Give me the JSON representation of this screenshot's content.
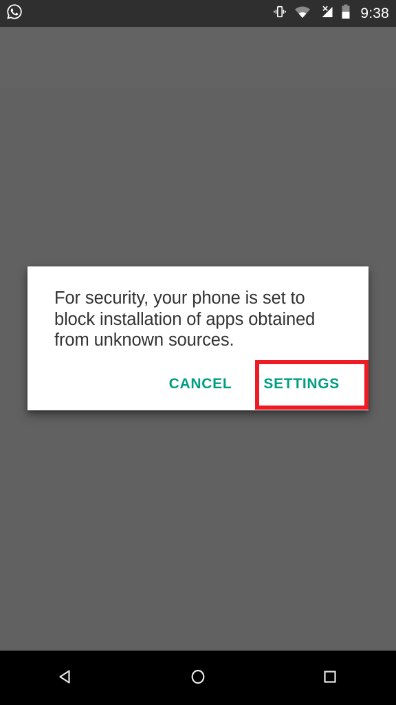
{
  "status_bar": {
    "notification_icon": "whatsapp-icon",
    "icons": [
      "vibrate-icon",
      "wifi-icon",
      "cellular-no-signal-icon",
      "battery-icon"
    ],
    "time": "9:38",
    "background_color": "#2f2f2f",
    "foreground_color": "#ffffff"
  },
  "dialog": {
    "message": "For security, your phone is set to block installation of apps obtained from unknown sources.",
    "cancel_label": "CANCEL",
    "settings_label": "SETTINGS",
    "accent_color": "#009e80",
    "surface_color": "#ffffff",
    "text_color": "#333333"
  },
  "annotation": {
    "highlight_target": "SETTINGS",
    "highlight_color": "#ed1c24"
  },
  "scrim": {
    "color": "#616161"
  },
  "nav_bar": {
    "background_color": "#000000",
    "buttons": [
      {
        "name": "back-icon",
        "label": "Back"
      },
      {
        "name": "home-icon",
        "label": "Home"
      },
      {
        "name": "recents-icon",
        "label": "Recents"
      }
    ]
  }
}
